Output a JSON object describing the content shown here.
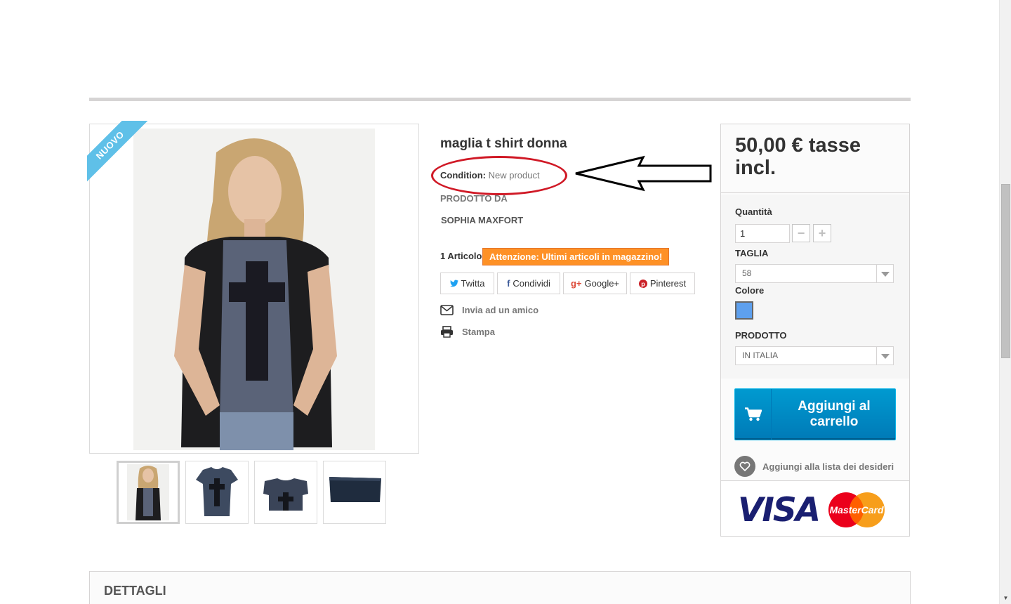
{
  "product": {
    "ribbon_label": "NUOVO",
    "title": "maglia t shirt donna",
    "condition_label": "Condition:",
    "condition_value": "New product",
    "brand_label": "PRODOTTO DA",
    "brand_name": "SOPHIA MAXFORT",
    "stock_quantity": "1 Articolo",
    "stock_warning": "Attenzione: Ultimi articoli in magazzino!"
  },
  "social": {
    "twitter": "Twitta",
    "facebook": "Condividi",
    "googleplus": "Google+",
    "pinterest": "Pinterest"
  },
  "links": {
    "send_to_friend": "Invia ad un amico",
    "print": "Stampa"
  },
  "buy_box": {
    "price": "50,00 € tasse incl.",
    "quantity_label": "Quantità",
    "quantity_value": "1",
    "size_label": "TAGLIA",
    "size_value": "58",
    "color_label": "Colore",
    "color_swatch": "#5ea0ee",
    "product_label": "PRODOTTO",
    "product_value": "IN ITALIA",
    "add_to_cart": "Aggiungi al carrello",
    "wishlist": "Aggiungi alla lista dei desideri",
    "payment_visa": "VISA",
    "payment_mastercard": "MasterCard"
  },
  "details": {
    "title": "DETTAGLI"
  },
  "colors": {
    "accent_blue": "#009ad0",
    "warning_orange": "#fe9126",
    "ribbon_blue": "#5fc0e8",
    "annotation_red": "#d01926"
  }
}
